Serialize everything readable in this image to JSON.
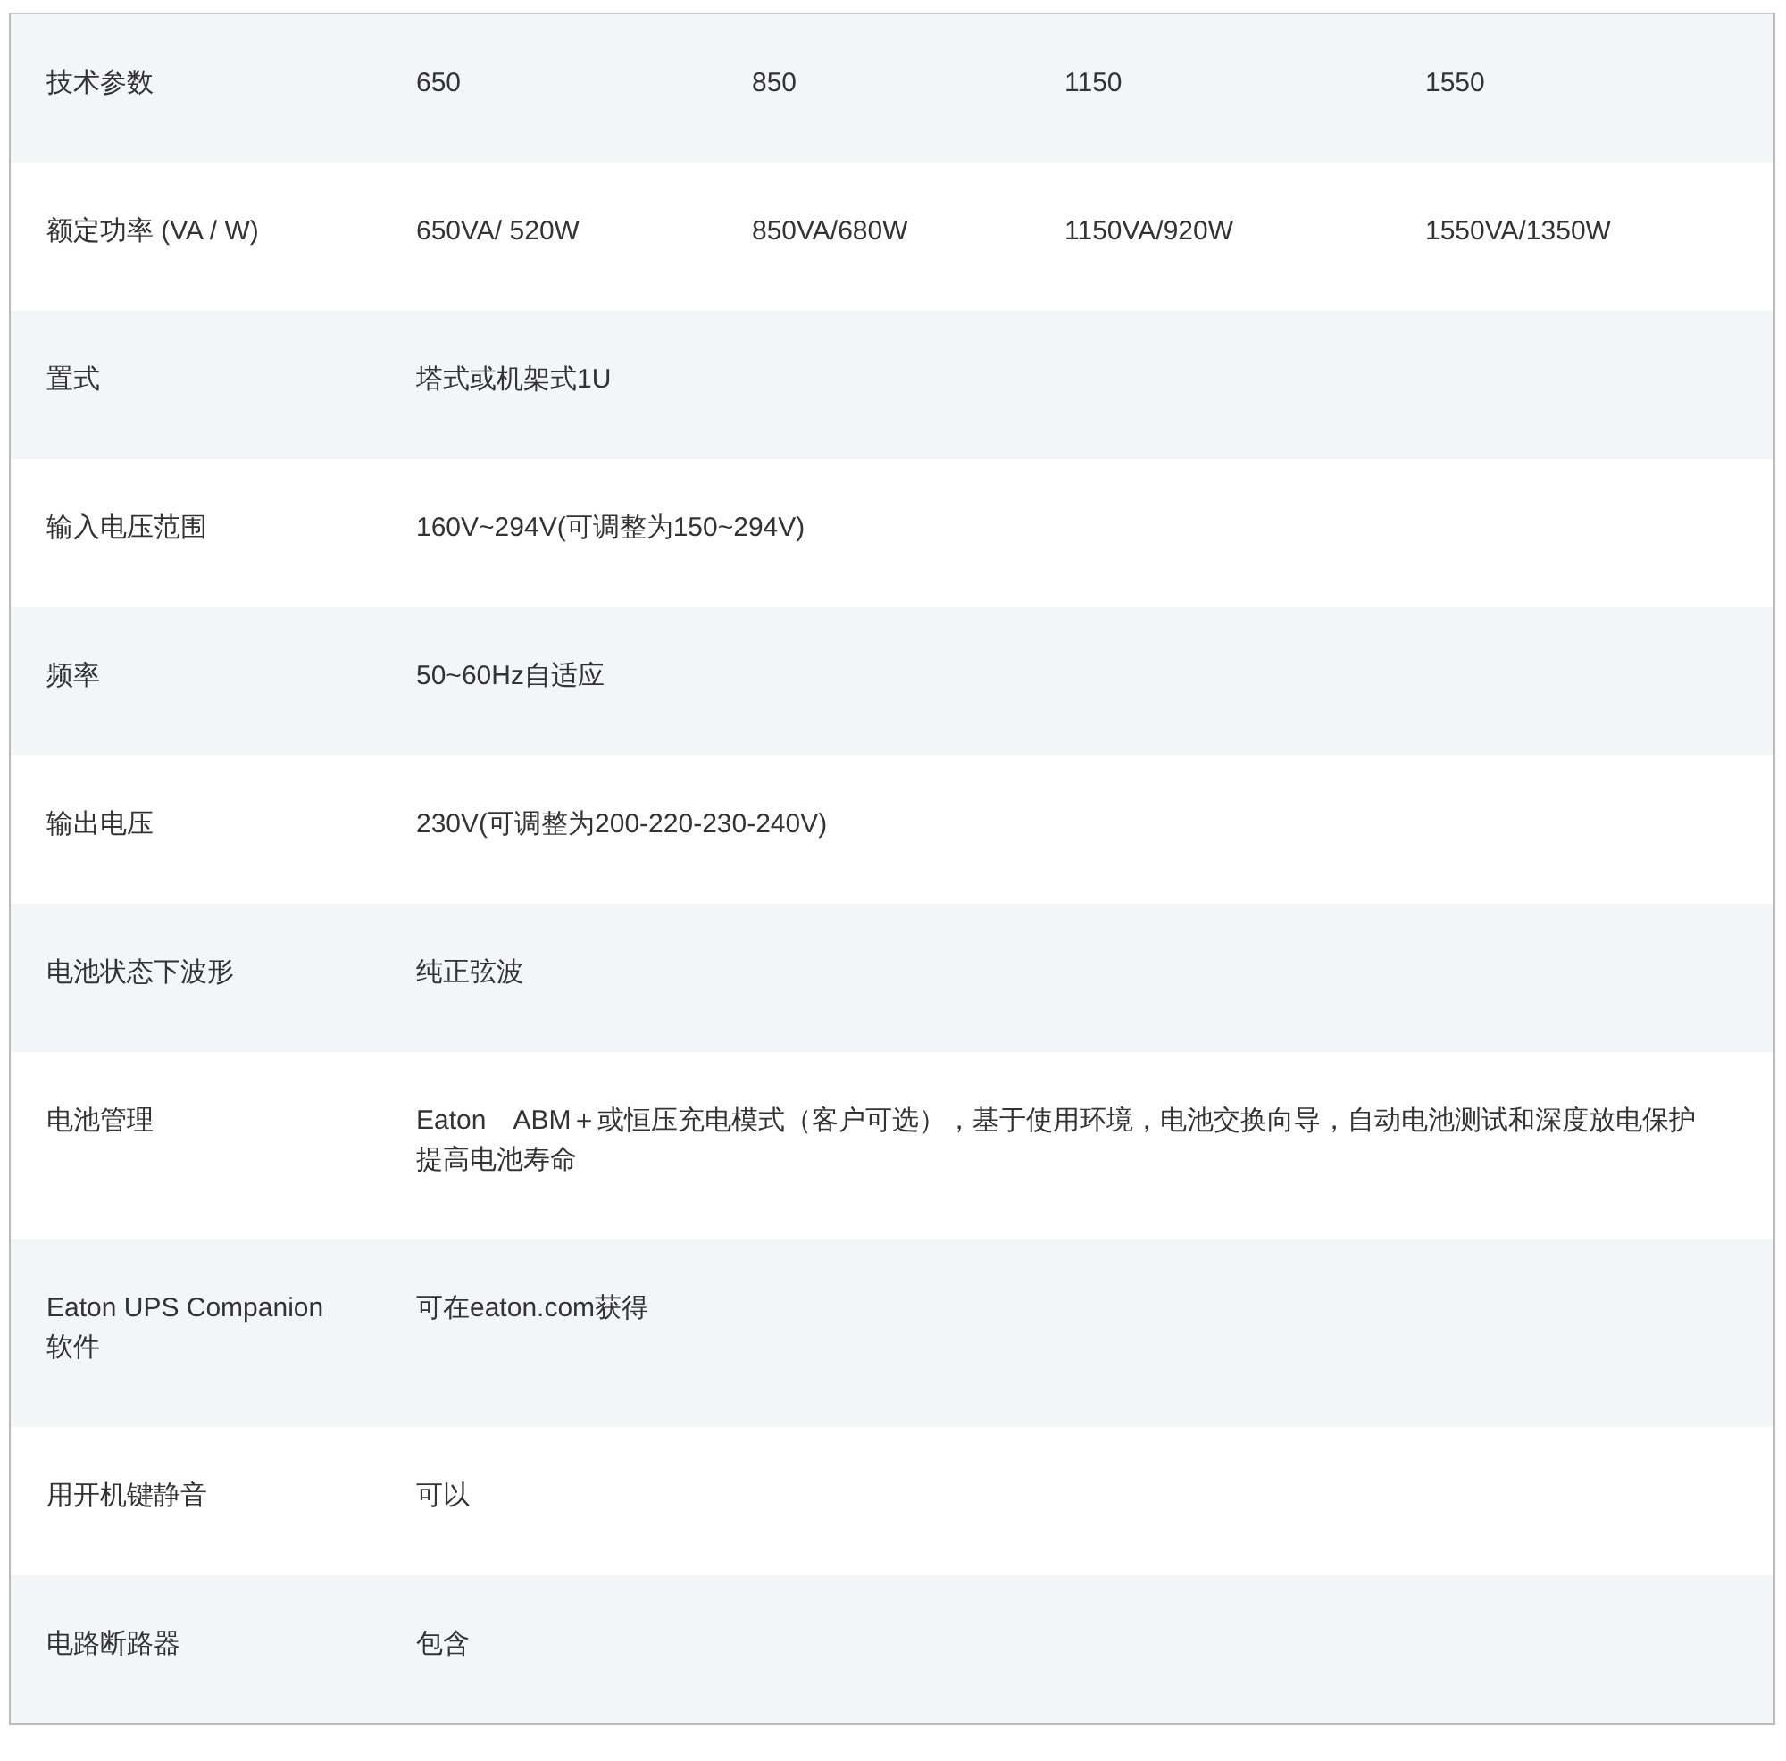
{
  "table": {
    "rows": [
      {
        "label": "技术参数",
        "values": [
          "650",
          "850",
          "1150",
          "1550"
        ]
      },
      {
        "label": "额定功率 (VA / W)",
        "values": [
          "650VA/ 520W",
          "850VA/680W",
          "1150VA/920W",
          "1550VA/1350W"
        ]
      },
      {
        "label": "置式",
        "values": [
          "塔式或机架式1U"
        ]
      },
      {
        "label": "输入电压范围",
        "values": [
          "160V~294V(可调整为150~294V)"
        ]
      },
      {
        "label": "频率",
        "values": [
          "50~60Hz自适应"
        ]
      },
      {
        "label": "输出电压",
        "values": [
          "230V(可调整为200-220-230-240V)"
        ]
      },
      {
        "label": "电池状态下波形",
        "values": [
          "纯正弦波"
        ]
      },
      {
        "label": "电池管理",
        "values": [
          "Eaton　ABM＋或恒压充电模式（客户可选），基于使用环境，电池交换向导，自动电池测试和深度放电保护提高电池寿命"
        ]
      },
      {
        "label": "Eaton UPS Companion 软件",
        "values": [
          "可在eaton.com获得"
        ]
      },
      {
        "label": "用开机键静音",
        "values": [
          "可以"
        ]
      },
      {
        "label": "电路断路器",
        "values": [
          "包含"
        ]
      }
    ]
  }
}
